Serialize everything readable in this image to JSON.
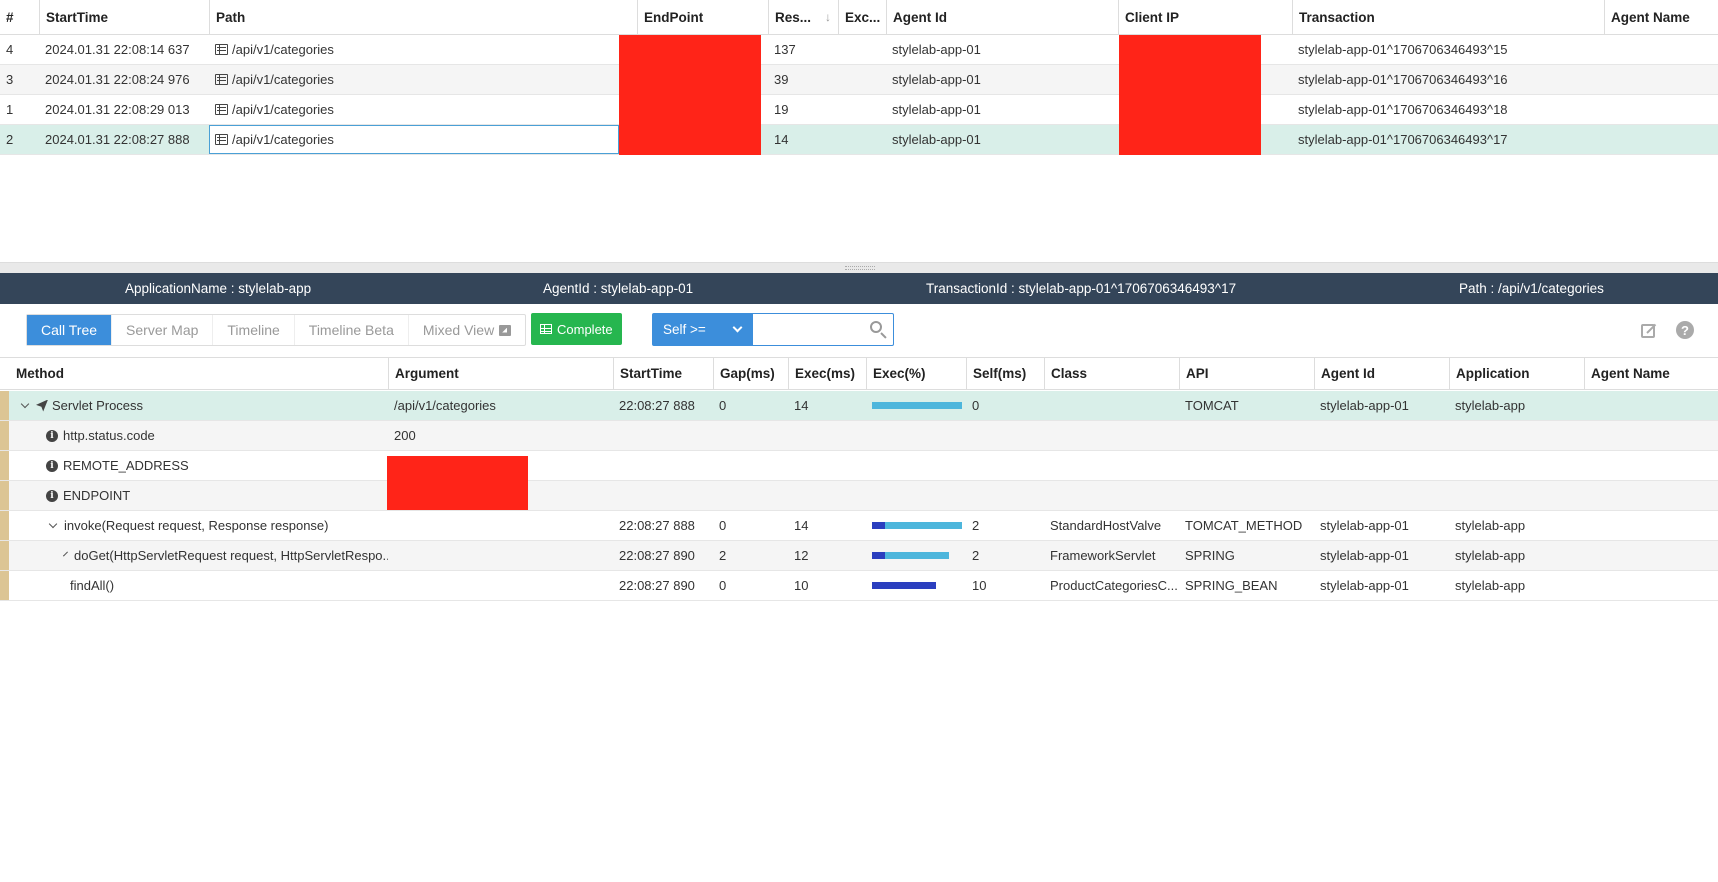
{
  "tx_table": {
    "headers": [
      "#",
      "StartTime",
      "Path",
      "EndPoint",
      "Res...",
      "Exc...",
      "Agent Id",
      "Client IP",
      "Transaction",
      "Agent Name"
    ],
    "sort_indicator": "↓",
    "rows": [
      {
        "num": "4",
        "start": "2024.01.31 22:08:14 637",
        "path": "/api/v1/categories",
        "res": "137",
        "agent": "stylelab-app-01",
        "tx": "stylelab-app-01^1706706346493^15"
      },
      {
        "num": "3",
        "start": "2024.01.31 22:08:24 976",
        "path": "/api/v1/categories",
        "res": "39",
        "agent": "stylelab-app-01",
        "tx": "stylelab-app-01^1706706346493^16"
      },
      {
        "num": "1",
        "start": "2024.01.31 22:08:29 013",
        "path": "/api/v1/categories",
        "res": "19",
        "agent": "stylelab-app-01",
        "tx": "stylelab-app-01^1706706346493^18"
      },
      {
        "num": "2",
        "start": "2024.01.31 22:08:27 888",
        "path": "/api/v1/categories",
        "res": "14",
        "agent": "stylelab-app-01",
        "tx": "stylelab-app-01^1706706346493^17"
      }
    ]
  },
  "info_bar": {
    "application": "ApplicationName : stylelab-app",
    "agent": "AgentId : stylelab-app-01",
    "transaction": "TransactionId : stylelab-app-01^1706706346493^17",
    "path": "Path : /api/v1/categories"
  },
  "toolbar": {
    "tabs": [
      "Call Tree",
      "Server Map",
      "Timeline",
      "Timeline Beta",
      "Mixed View"
    ],
    "complete_label": "Complete",
    "filter_label": "Self >=",
    "filter_value": "",
    "help_glyph": "?"
  },
  "call_tree": {
    "headers": [
      "Method",
      "Argument",
      "StartTime",
      "Gap(ms)",
      "Exec(ms)",
      "Exec(%)",
      "Self(ms)",
      "Class",
      "API",
      "Agent Id",
      "Application",
      "Agent Name"
    ],
    "rows": [
      {
        "method": "Servlet Process",
        "argument": "/api/v1/categories",
        "start": "22:08:27 888",
        "gap": "0",
        "exec": "14",
        "exec_pct": 100,
        "self_pct": 0,
        "self": "0",
        "class": "",
        "api": "TOMCAT",
        "agent": "stylelab-app-01",
        "app": "stylelab-app"
      },
      {
        "method": "http.status.code",
        "argument": "200"
      },
      {
        "method": "REMOTE_ADDRESS",
        "argument": ""
      },
      {
        "method": "ENDPOINT",
        "argument": ""
      },
      {
        "method": "invoke(Request request, Response response)",
        "argument": "",
        "start": "22:08:27 888",
        "gap": "0",
        "exec": "14",
        "exec_pct": 100,
        "self_pct": 14,
        "self": "2",
        "class": "StandardHostValve",
        "api": "TOMCAT_METHOD",
        "agent": "stylelab-app-01",
        "app": "stylelab-app"
      },
      {
        "method": "doGet(HttpServletRequest request, HttpServletRespo...",
        "argument": "",
        "start": "22:08:27 890",
        "gap": "2",
        "exec": "12",
        "exec_pct": 86,
        "self_pct": 14,
        "self": "2",
        "class": "FrameworkServlet",
        "api": "SPRING",
        "agent": "stylelab-app-01",
        "app": "stylelab-app"
      },
      {
        "method": "findAll()",
        "argument": "",
        "start": "22:08:27 890",
        "gap": "0",
        "exec": "10",
        "exec_pct": 71,
        "self_pct": 71,
        "self": "10",
        "class": "ProductCategoriesC...",
        "api": "SPRING_BEAN",
        "agent": "stylelab-app-01",
        "app": "stylelab-app"
      }
    ]
  },
  "colors": {
    "exec_bar": "#4db6dc",
    "self_bar": "#2b3fbf",
    "selected_row": "#d9efe9",
    "redaction": "#ff2418",
    "info_bar_bg": "#344559",
    "active_tab": "#3c8edb",
    "complete_btn": "#26b64f"
  }
}
